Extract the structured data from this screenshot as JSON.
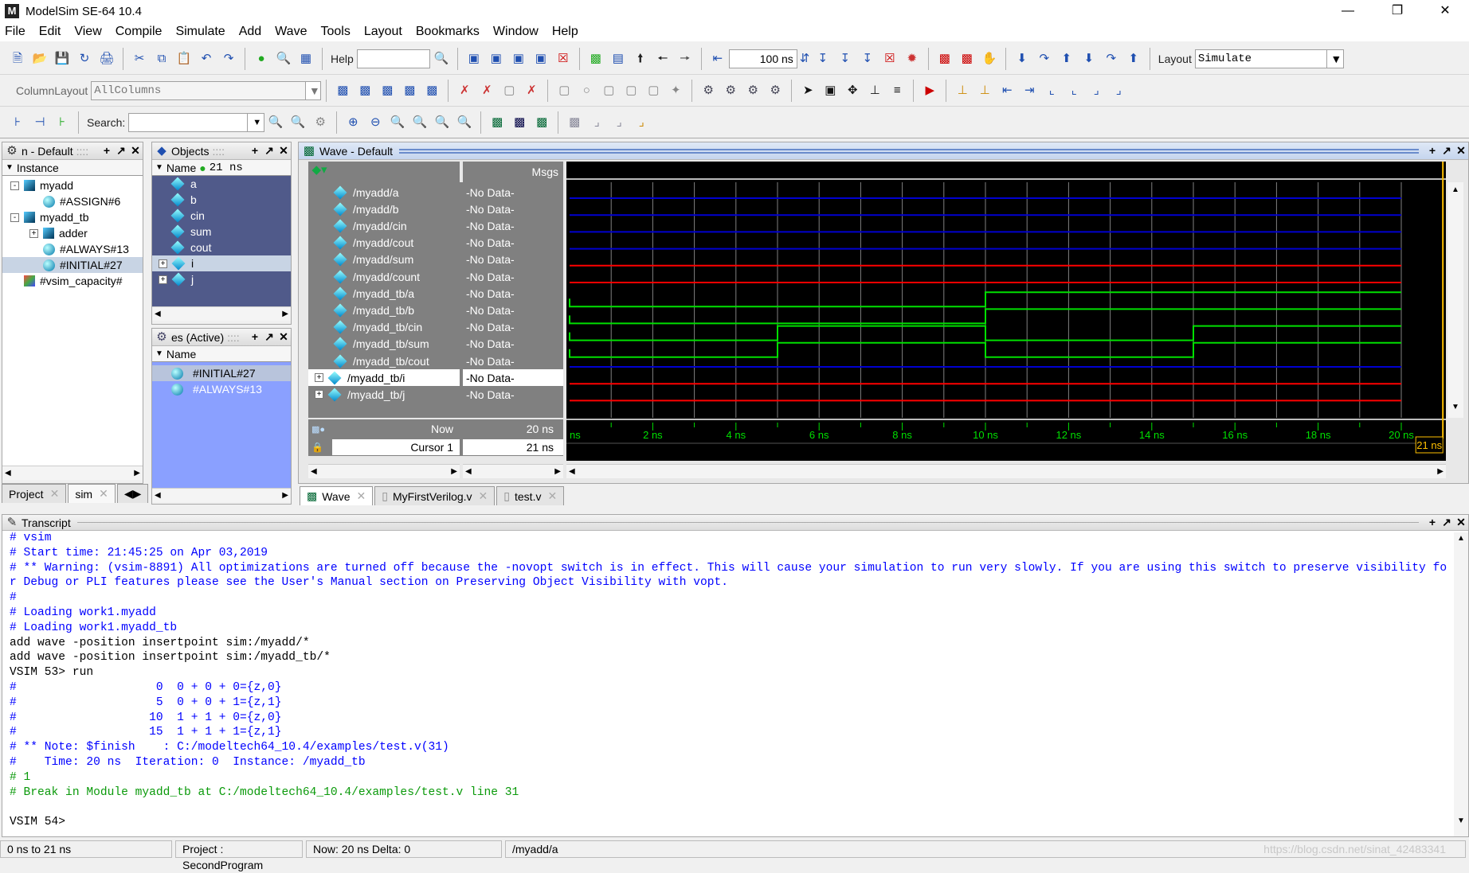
{
  "app": {
    "title": "ModelSim SE-64 10.4",
    "logo": "M"
  },
  "menu": [
    "File",
    "Edit",
    "View",
    "Compile",
    "Simulate",
    "Add",
    "Wave",
    "Tools",
    "Layout",
    "Bookmarks",
    "Window",
    "Help"
  ],
  "toolbar": {
    "help_label": "Help",
    "help_value": "",
    "time_value": "100 ns",
    "layout_label": "Layout",
    "layout_value": "Simulate",
    "column_layout_label": "ColumnLayout",
    "column_layout_value": "AllColumns",
    "search_label": "Search:",
    "search_value": ""
  },
  "sim_panel": {
    "title": "n - Default",
    "column": "Instance",
    "items": [
      {
        "label": "myadd",
        "type": "module",
        "level": 0,
        "expander": "-"
      },
      {
        "label": "#ASSIGN#6",
        "type": "process",
        "level": 1
      },
      {
        "label": "myadd_tb",
        "type": "module",
        "level": 0,
        "expander": "-"
      },
      {
        "label": "adder",
        "type": "module",
        "level": 1,
        "expander": "+"
      },
      {
        "label": "#ALWAYS#13",
        "type": "process",
        "level": 1
      },
      {
        "label": "#INITIAL#27",
        "type": "process",
        "level": 1,
        "selected": true
      },
      {
        "label": "#vsim_capacity#",
        "type": "capacity",
        "level": 0
      }
    ]
  },
  "objects_panel": {
    "title": "Objects",
    "column": "Name",
    "time": "21 ns",
    "items": [
      {
        "label": "a"
      },
      {
        "label": "b"
      },
      {
        "label": "cin"
      },
      {
        "label": "sum"
      },
      {
        "label": "cout"
      },
      {
        "label": "i",
        "expander": "+",
        "selected": true
      },
      {
        "label": "j",
        "expander": "+"
      }
    ]
  },
  "processes_panel": {
    "title": "es (Active)",
    "column": "Name",
    "items": [
      {
        "label": "#INITIAL#27",
        "selected": true
      },
      {
        "label": "#ALWAYS#13"
      }
    ]
  },
  "left_tabs": [
    {
      "label": "Project"
    },
    {
      "label": "sim"
    }
  ],
  "wave": {
    "title": "Wave - Default",
    "msgs_label": "Msgs",
    "now_label": "Now",
    "now_value": "20 ns",
    "cursor_label": "Cursor 1",
    "cursor_value": "21 ns",
    "cursor_time": 21,
    "time_ticks": [
      "ns",
      "2 ns",
      "4 ns",
      "6 ns",
      "8 ns",
      "10 ns",
      "12 ns",
      "14 ns",
      "16 ns",
      "18 ns",
      "20 ns"
    ],
    "time_range_ns": [
      0,
      20
    ],
    "colors": {
      "z": "#0000d0",
      "x": "#ff0000",
      "logic": "#00e000",
      "grid": "#808080",
      "cursor": "#ffc000"
    },
    "signals": [
      {
        "name": "/myadd/a",
        "value": "-No Data-",
        "kind": "z"
      },
      {
        "name": "/myadd/b",
        "value": "-No Data-",
        "kind": "z"
      },
      {
        "name": "/myadd/cin",
        "value": "-No Data-",
        "kind": "z"
      },
      {
        "name": "/myadd/cout",
        "value": "-No Data-",
        "kind": "z"
      },
      {
        "name": "/myadd/sum",
        "value": "-No Data-",
        "kind": "x"
      },
      {
        "name": "/myadd/count",
        "value": "-No Data-",
        "kind": "x"
      },
      {
        "name": "/myadd_tb/a",
        "value": "-No Data-",
        "kind": "logic",
        "transitions": [
          [
            0,
            0
          ],
          [
            10,
            1
          ]
        ]
      },
      {
        "name": "/myadd_tb/b",
        "value": "-No Data-",
        "kind": "logic",
        "transitions": [
          [
            0,
            0
          ],
          [
            10,
            1
          ]
        ]
      },
      {
        "name": "/myadd_tb/cin",
        "value": "-No Data-",
        "kind": "logic",
        "transitions": [
          [
            0,
            0
          ],
          [
            5,
            1
          ],
          [
            10,
            0
          ],
          [
            15,
            1
          ]
        ]
      },
      {
        "name": "/myadd_tb/sum",
        "value": "-No Data-",
        "kind": "logic",
        "transitions": [
          [
            0,
            0
          ],
          [
            5,
            1
          ],
          [
            10,
            0
          ],
          [
            15,
            1
          ]
        ]
      },
      {
        "name": "/myadd_tb/cout",
        "value": "-No Data-",
        "kind": "z"
      },
      {
        "name": "/myadd_tb/i",
        "value": "-No Data-",
        "kind": "x",
        "expander": "+",
        "selected": true
      },
      {
        "name": "/myadd_tb/j",
        "value": "-No Data-",
        "kind": "x",
        "expander": "+"
      }
    ]
  },
  "doc_tabs": [
    {
      "label": "Wave"
    },
    {
      "label": "MyFirstVerilog.v"
    },
    {
      "label": "test.v"
    }
  ],
  "transcript": {
    "title": "Transcript",
    "lines": [
      {
        "text": "# vsim",
        "color": "blue"
      },
      {
        "text": "# Start time: 21:45:25 on Apr 03,2019",
        "color": "blue"
      },
      {
        "text": "# ** Warning: (vsim-8891) All optimizations are turned off because the -novopt switch is in effect. This will cause your simulation to run very slowly. If you are using this switch to preserve visibility fo",
        "color": "blue"
      },
      {
        "text": "r Debug or PLI features please see the User's Manual section on Preserving Object Visibility with vopt.",
        "color": "blue"
      },
      {
        "text": "#",
        "color": "blue"
      },
      {
        "text": "# Loading work1.myadd",
        "color": "blue"
      },
      {
        "text": "# Loading work1.myadd_tb",
        "color": "blue"
      },
      {
        "text": "add wave -position insertpoint sim:/myadd/*",
        "color": "black"
      },
      {
        "text": "add wave -position insertpoint sim:/myadd_tb/*",
        "color": "black"
      },
      {
        "text": "VSIM 53> run",
        "color": "black"
      },
      {
        "text": "#                    0  0 + 0 + 0={z,0}",
        "color": "blue"
      },
      {
        "text": "#                    5  0 + 0 + 1={z,1}",
        "color": "blue"
      },
      {
        "text": "#                   10  1 + 1 + 0={z,0}",
        "color": "blue"
      },
      {
        "text": "#                   15  1 + 1 + 1={z,1}",
        "color": "blue"
      },
      {
        "text": "# ** Note: $finish    : C:/modeltech64_10.4/examples/test.v(31)",
        "color": "blue"
      },
      {
        "text": "#    Time: 20 ns  Iteration: 0  Instance: /myadd_tb",
        "color": "blue"
      },
      {
        "text": "# 1",
        "color": "green"
      },
      {
        "text": "# Break in Module myadd_tb at C:/modeltech64_10.4/examples/test.v line 31",
        "color": "green"
      },
      {
        "text": "",
        "color": "black"
      },
      {
        "text": "VSIM 54>",
        "color": "black"
      }
    ]
  },
  "status": {
    "range": "0 ns to 21 ns",
    "project": "Project : SecondProgram",
    "now": "Now: 20 ns  Delta: 0",
    "signal": "/myadd/a"
  },
  "watermark": "https://blog.csdn.net/sinat_42483341"
}
